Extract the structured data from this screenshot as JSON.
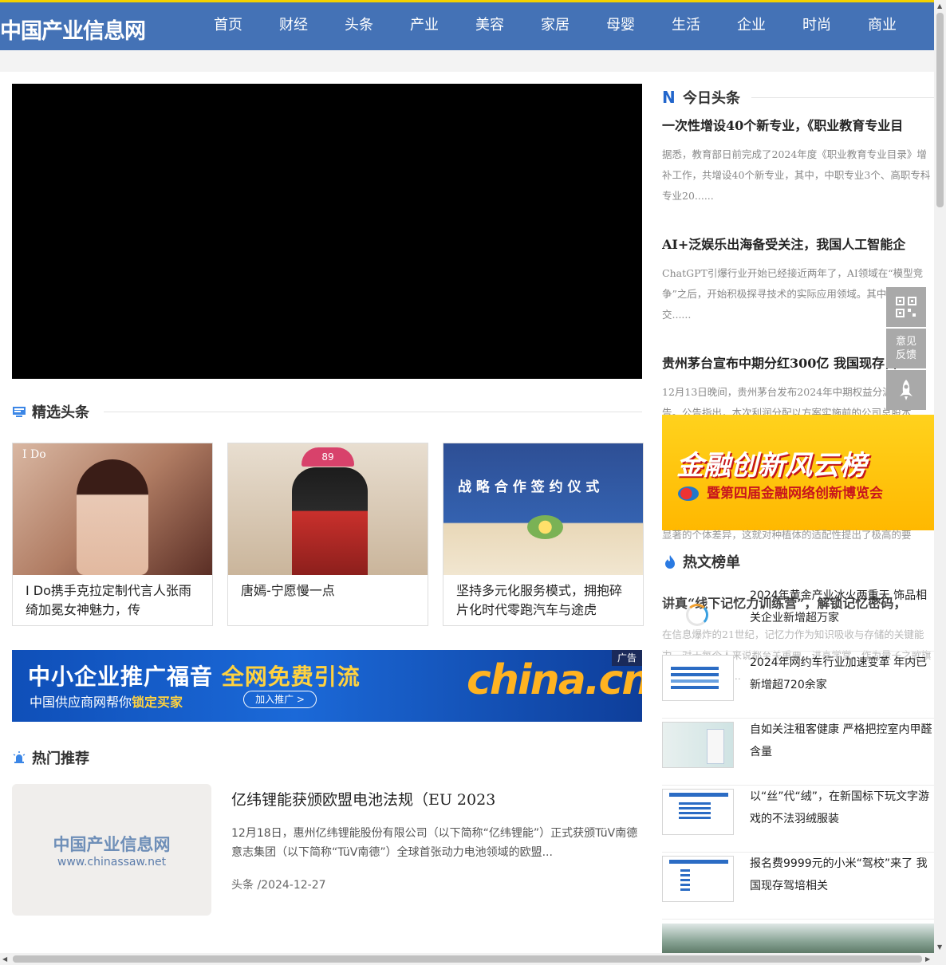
{
  "header": {
    "logo": "中国产业信息网",
    "nav": [
      "首页",
      "财经",
      "头条",
      "产业",
      "美容",
      "家居",
      "母婴",
      "生活",
      "企业",
      "时尚",
      "商业"
    ]
  },
  "sections": {
    "featured": "精选头条",
    "hot": "热门推荐"
  },
  "cards": [
    {
      "caption": "I Do携手克拉定制代言人张雨绮加冕女神魅力，传",
      "img_text": "I Do"
    },
    {
      "caption": "唐嫣-宁愿慢一点",
      "img_text": "89"
    },
    {
      "caption": "坚持多元化服务模式，拥抱碎片化时代零跑汽车与途虎",
      "img_text": "战 略 合 作 签 约 仪 式"
    }
  ],
  "banner": {
    "line1_a": "中小企业推广福音 ",
    "line1_b": "全网免费引流",
    "line2_a": "中国供应商网帮你",
    "line2_b": "锁定买家",
    "button": "加入推广 >",
    "ad_label": "广告",
    "brand": "china.cn"
  },
  "hot_item": {
    "img_line1": "中国产业信息网",
    "img_line2": "www.chinassaw.net",
    "title": "亿纬锂能获颁欧盟电池法规（EU 2023",
    "desc": "12月18日，惠州亿纬锂能股份有限公司（以下简称“亿纬锂能”）正式获颁TüV南德意志集团（以下简称“TüV南德”）全球首张动力电池领域的欧盟...",
    "meta": "头条 /2024-12-27"
  },
  "right": {
    "today_title": "今日头条",
    "today_icon": "N",
    "news": [
      {
        "title": "一次性增设40个新专业，《职业教育专业目",
        "desc": "据悉，教育部日前完成了2024年度《职业教育专业目录》增补工作，共增设40个新专业，其中，中职专业3个、高职专科专业20......"
      },
      {
        "title": "AI+泛娱乐出海备受关注，我国人工智能企",
        "desc": "ChatGPT引爆行业开始已经接近两年了，AI领域在“模型竞争”之后，开始积极探寻技术的实际应用领域。其中，AI交......"
      },
      {
        "title": "贵州茅台宣布中期分红300亿 我国现存白",
        "desc": "12月13日晚间，贵州茅台发布2024年中期权益分派实施公告。公告指出，本次利润分配以方案实施前的公司总股本..."
      }
    ],
    "ad": {
      "line1": "金融创新风云榜",
      "line2": "暨第四届金融网络创新博览会"
    },
    "ad_under_text": "显著的个体差异，这就对种植体的适配性提出了极高的要",
    "overlap": {
      "title": "讲真“线下记忆力训练营”，解锁记忆密码，",
      "desc": "在信息爆炸的21世纪，记忆力作为知识吸收与存储的关键能力，对于每个人来说都至关重要。进喜学堂，作为量子之歌旗下致力于个人......"
    },
    "hot_title": "热文榜单",
    "hot_list": [
      "2024年黄金产业冰火两重天 饰品相关企业新增超万家",
      "2024年网约车行业加速变革 年内已新增超720余家",
      "自如关注租客健康 严格把控室内甲醛含量",
      "以“丝”代“绒”，在新国标下玩文字游戏的不法羽绒服装",
      "报名费9999元的小米“驾校”来了 我国现存驾培相关"
    ]
  },
  "float": {
    "feedback": "意见反馈"
  },
  "colors": {
    "header": "#4472b6",
    "accent_bar": "#f3d200",
    "link_blue": "#2266cc"
  }
}
